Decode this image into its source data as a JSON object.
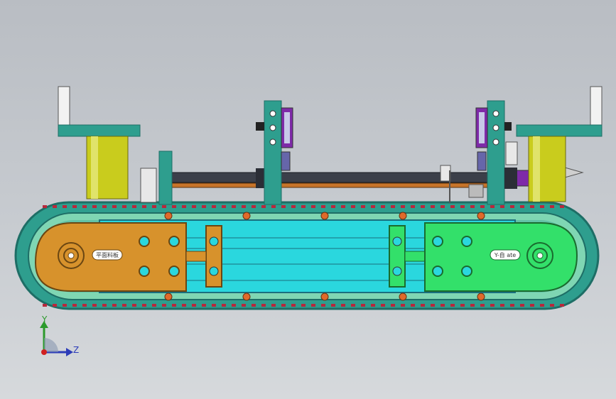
{
  "viewport": {
    "background": [
      "#b9bdc3",
      "#d6d9dc"
    ]
  },
  "model": {
    "colors": {
      "teal": "#2e9e8e",
      "teal_dark": "#1e6e66",
      "cyan_frame": "#2ad7de",
      "orange_plate": "#d7922c",
      "green_plate": "#33e06a",
      "olive_column": "#c9cc1d",
      "track_link": "#7fd6b3",
      "track_pin": "#b7283c",
      "shaft": "#3b3f49",
      "roller": "#e06a2a"
    },
    "left_plate_text": "平面料板",
    "right_plate_text": "Y-自 ate"
  },
  "triad": {
    "x_label": "",
    "y_label": "Y",
    "z_label": "Z"
  }
}
